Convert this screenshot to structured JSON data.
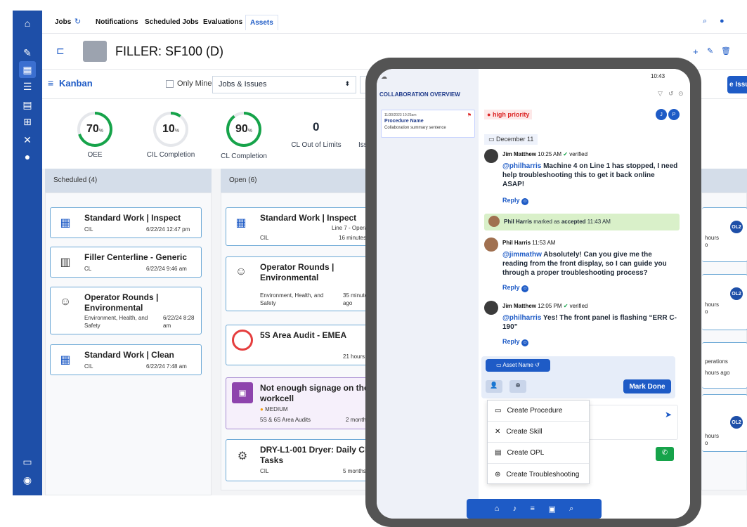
{
  "tabs": [
    "Jobs",
    "Notifications",
    "Scheduled Jobs",
    "Evaluations",
    "Assets"
  ],
  "asset_title": "FILLER: SF100 (D)",
  "kanban_label": "Kanban",
  "only_mine": "Only Mine",
  "filter_select": "Jobs & Issues",
  "create_issue": "e Issue",
  "metrics": {
    "oee": {
      "value": "70",
      "unit": "%",
      "label": "OEE",
      "fraction": 0.7
    },
    "cil": {
      "value": "10",
      "unit": "%",
      "label": "CIL Completion",
      "fraction": 0.1
    },
    "cl": {
      "value": "90",
      "unit": "%",
      "label": "CL Completion",
      "fraction": 0.9
    },
    "out": {
      "value": "0",
      "label": "CL Out of Limits"
    },
    "issues": {
      "label": "Issu"
    }
  },
  "scheduled": {
    "header": "Scheduled (4)",
    "cards": [
      {
        "title": "Standard Work | Inspect",
        "type": "CIL",
        "date": "6/22/24 12:47 pm"
      },
      {
        "title": "Filler Centerline - Generic",
        "type": "CL",
        "date": "6/22/24 9:46 am"
      },
      {
        "title": "Operator Rounds |",
        "title2": "Environmental",
        "type": "Environment, Health, and",
        "type2": "Safety",
        "date": "6/22/24 8:28",
        "date2": "am"
      },
      {
        "title": "Standard Work | Clean",
        "type": "CIL",
        "date": "6/22/24 7:48 am"
      }
    ]
  },
  "open": {
    "header": "Open (6)",
    "cards": [
      {
        "title": "Standard Work | Inspect",
        "line": "Line 7 - Operat",
        "type": "CIL",
        "time": "16 minutes"
      },
      {
        "title": "Operator Rounds |",
        "title2": "Environmental",
        "type": "Environment, Health, and",
        "type2": "Safety",
        "time": "35 minute",
        "time2": "ago"
      },
      {
        "title": "5S Area Audit - EMEA",
        "time": "21 hours"
      },
      {
        "title": "Not enough signage on the",
        "title2": "workcell",
        "priority": "MEDIUM",
        "type": "5S & 6S Area Audits",
        "time": "2 months"
      },
      {
        "title": "DRY-L1-001 Dryer: Daily CIL",
        "title2": "Tasks",
        "type": "CIL",
        "time": "5 months"
      }
    ]
  },
  "right_column": {
    "chip": "OL2",
    "texts": [
      "hours",
      "o",
      "hours",
      "o",
      "perations",
      "hours ago",
      "hours",
      "o"
    ]
  },
  "tablet": {
    "time": "10:43",
    "collab_title": "COLLABORATION OVERVIEW",
    "preview": {
      "stamp": "11/30/2023 10:25am",
      "name": "Procedure Name",
      "summary": "Collaboration summary sentence"
    },
    "priority": "high priority",
    "avatars": [
      "J",
      "P"
    ],
    "date": "December 11",
    "messages": [
      {
        "author": "Jim Matthew",
        "time": "10:25 AM",
        "verified": "verified",
        "mention": "@philharris",
        "text": " Machine 4 on Line 1 has stopped, I need help troubleshooting this to get it back online ASAP!",
        "reply": "Reply"
      },
      {
        "author": "Phil Harris",
        "time": "11:53 AM",
        "mention": "@jimmathw",
        "text": " Absolutely! Can you give me the reading from the front display, so I can guide you through a proper troubleshooting process?",
        "reply": "Reply"
      },
      {
        "author": "Jim Matthew",
        "time": "12:05 PM",
        "verified": "verified",
        "mention": "@philharris",
        "text": " Yes! The front panel is flashing “ERR C-190”",
        "reply": "Reply"
      }
    ],
    "accepted": {
      "author": "Phil Harris",
      "pre": "marked as",
      "word": "accepted",
      "time": "11:43 AM"
    },
    "asset_name": "Asset Name",
    "mark_done": "Mark Done",
    "menu": [
      "Create Procedure",
      "Create Skill",
      "Create OPL",
      "Create Troubleshooting"
    ]
  },
  "colors": {
    "brand": "#1e4fa8",
    "accent": "#1e5bc6",
    "green": "#16a34a",
    "red": "#dc2626"
  }
}
